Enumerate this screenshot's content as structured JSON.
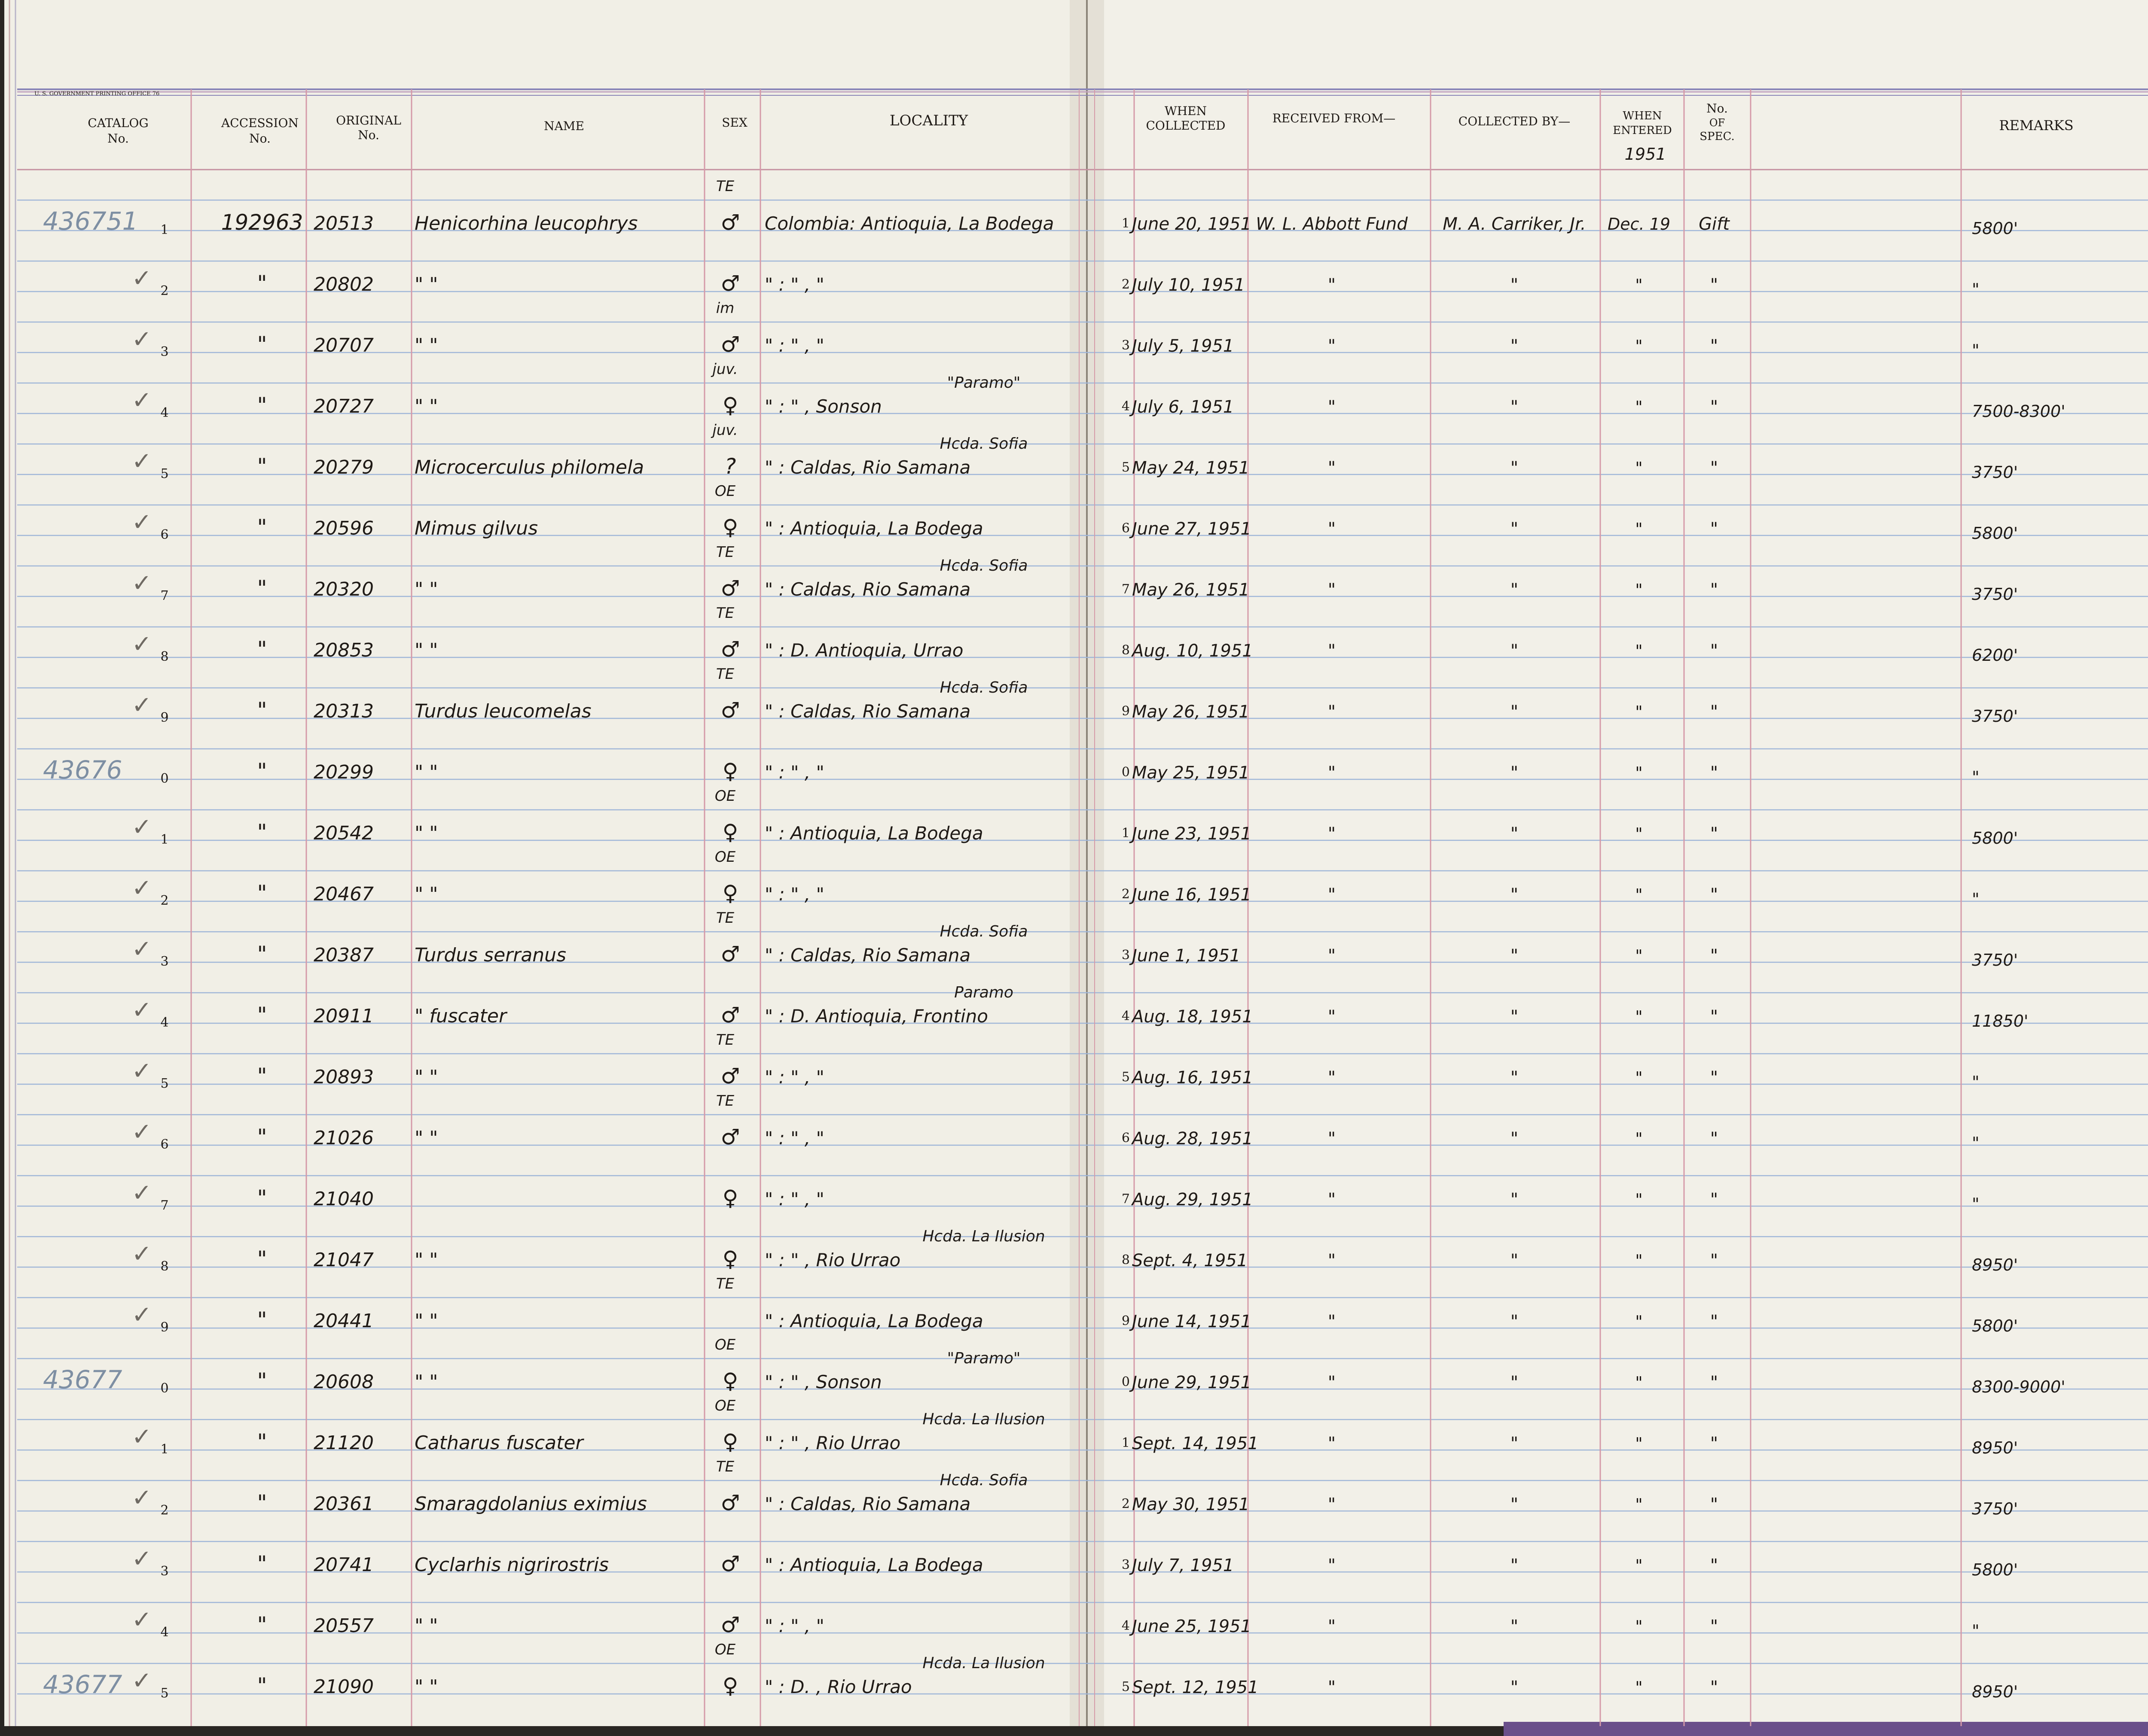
{
  "printer_imprint": "U. S. GOVERNMENT PRINTING OFFICE   76",
  "headers": {
    "catalog_no": [
      "CATALOG",
      "No."
    ],
    "accession_no": [
      "ACCESSION",
      "No."
    ],
    "original_no": [
      "ORIGINAL",
      "No."
    ],
    "name": "NAME",
    "sex": "SEX",
    "locality": "LOCALITY",
    "when_collected": [
      "WHEN",
      "COLLECTED"
    ],
    "received_from": "RECEIVED FROM—",
    "collected_by": "COLLECTED BY—",
    "when_entered": [
      "WHEN",
      "ENTERED"
    ],
    "no_of_spec": [
      "No.",
      "OF",
      "SPEC."
    ],
    "remarks": "REMARKS",
    "year_note": "1951"
  },
  "rows": [
    {
      "check": "",
      "catalog": "436751",
      "line": "1",
      "accession": "192963",
      "original": "20513",
      "name": "Henicorhina leucophrys",
      "sex_note": "TE",
      "sex": "♂",
      "locality_note": "",
      "locality": "Colombia: Antioquia, La Bodega",
      "date": "June 20, 1951",
      "received": "W. L. Abbott Fund",
      "collector": "M. A. Carriker, Jr.",
      "entered": "Dec. 19",
      "spec": "Gift",
      "remarks": "5800'"
    },
    {
      "check": "✓",
      "catalog": "",
      "line": "2",
      "accession": "\"",
      "original": "20802",
      "name": "\"   \"",
      "sex_note": "",
      "sex": "♂",
      "locality_note": "",
      "locality": "\" : \" , \"",
      "date": "July 10, 1951",
      "received": "\"",
      "collector": "\"",
      "entered": "\"",
      "spec": "\"",
      "remarks": "\""
    },
    {
      "check": "✓",
      "catalog": "",
      "line": "3",
      "accession": "\"",
      "original": "20707",
      "name": "\"   \"",
      "sex_note": "im",
      "sex": "♂",
      "locality_note": "",
      "locality": "\" : \" , \"",
      "date": "July 5, 1951",
      "received": "\"",
      "collector": "\"",
      "entered": "\"",
      "spec": "\"",
      "remarks": "\""
    },
    {
      "check": "✓",
      "catalog": "",
      "line": "4",
      "accession": "\"",
      "original": "20727",
      "name": "\"   \"",
      "sex_note": "juv.",
      "sex": "♀",
      "locality_note": "\"Paramo\"",
      "locality": "\" : \" , Sonson",
      "date": "July 6, 1951",
      "received": "\"",
      "collector": "\"",
      "entered": "\"",
      "spec": "\"",
      "remarks": "7500-8300'"
    },
    {
      "check": "✓",
      "catalog": "",
      "line": "5",
      "accession": "\"",
      "original": "20279",
      "name": "Microcerculus philomela",
      "sex_note": "juv.",
      "sex": "?",
      "locality_note": "Hcda. Sofia",
      "locality": "\" : Caldas, Rio Samana",
      "date": "May 24, 1951",
      "received": "\"",
      "collector": "\"",
      "entered": "\"",
      "spec": "\"",
      "remarks": "3750'"
    },
    {
      "check": "✓",
      "catalog": "",
      "line": "6",
      "accession": "\"",
      "original": "20596",
      "name": "Mimus gilvus",
      "sex_note": "OE",
      "sex": "♀",
      "locality_note": "",
      "locality": "\" : Antioquia, La Bodega",
      "date": "June 27, 1951",
      "received": "\"",
      "collector": "\"",
      "entered": "\"",
      "spec": "\"",
      "remarks": "5800'"
    },
    {
      "check": "✓",
      "catalog": "",
      "line": "7",
      "accession": "\"",
      "original": "20320",
      "name": "\"   \"",
      "sex_note": "TE",
      "sex": "♂",
      "locality_note": "Hcda. Sofia",
      "locality": "\" : Caldas, Rio Samana",
      "date": "May 26, 1951",
      "received": "\"",
      "collector": "\"",
      "entered": "\"",
      "spec": "\"",
      "remarks": "3750'"
    },
    {
      "check": "✓",
      "catalog": "",
      "line": "8",
      "accession": "\"",
      "original": "20853",
      "name": "\"   \"",
      "sex_note": "TE",
      "sex": "♂",
      "locality_note": "",
      "locality": "\" : D. Antioquia, Urrao",
      "date": "Aug. 10, 1951",
      "received": "\"",
      "collector": "\"",
      "entered": "\"",
      "spec": "\"",
      "remarks": "6200'"
    },
    {
      "check": "✓",
      "catalog": "",
      "line": "9",
      "accession": "\"",
      "original": "20313",
      "name": "Turdus leucomelas",
      "sex_note": "TE",
      "sex": "♂",
      "locality_note": "Hcda. Sofia",
      "locality": "\" : Caldas, Rio Samana",
      "date": "May 26, 1951",
      "received": "\"",
      "collector": "\"",
      "entered": "\"",
      "spec": "\"",
      "remarks": "3750'"
    },
    {
      "check": "",
      "catalog": "43676",
      "line": "0",
      "accession": "\"",
      "original": "20299",
      "name": "\"   \"",
      "sex_note": "",
      "sex": "♀",
      "locality_note": "",
      "locality": "\" : \" , \"",
      "date": "May 25, 1951",
      "received": "\"",
      "collector": "\"",
      "entered": "\"",
      "spec": "\"",
      "remarks": "\""
    },
    {
      "check": "✓",
      "catalog": "",
      "line": "1",
      "accession": "\"",
      "original": "20542",
      "name": "\"   \"",
      "sex_note": "OE",
      "sex": "♀",
      "locality_note": "",
      "locality": "\" : Antioquia, La Bodega",
      "date": "June 23, 1951",
      "received": "\"",
      "collector": "\"",
      "entered": "\"",
      "spec": "\"",
      "remarks": "5800'"
    },
    {
      "check": "✓",
      "catalog": "",
      "line": "2",
      "accession": "\"",
      "original": "20467",
      "name": "\"   \"",
      "sex_note": "OE",
      "sex": "♀",
      "locality_note": "",
      "locality": "\" : \" , \"",
      "date": "June 16, 1951",
      "received": "\"",
      "collector": "\"",
      "entered": "\"",
      "spec": "\"",
      "remarks": "\""
    },
    {
      "check": "✓",
      "catalog": "",
      "line": "3",
      "accession": "\"",
      "original": "20387",
      "name": "Turdus serranus",
      "sex_note": "TE",
      "sex": "♂",
      "locality_note": "Hcda. Sofia",
      "locality": "\" : Caldas, Rio Samana",
      "date": "June 1, 1951",
      "received": "\"",
      "collector": "\"",
      "entered": "\"",
      "spec": "\"",
      "remarks": "3750'"
    },
    {
      "check": "✓",
      "catalog": "",
      "line": "4",
      "accession": "\"",
      "original": "20911",
      "name": "\" fuscater",
      "sex_note": "",
      "sex": "♂",
      "locality_note": "Paramo",
      "locality": "\" : D. Antioquia, Frontino",
      "date": "Aug. 18, 1951",
      "received": "\"",
      "collector": "\"",
      "entered": "\"",
      "spec": "\"",
      "remarks": "11850'"
    },
    {
      "check": "✓",
      "catalog": "",
      "line": "5",
      "accession": "\"",
      "original": "20893",
      "name": "\"   \"",
      "sex_note": "TE",
      "sex": "♂",
      "locality_note": "",
      "locality": "\" : \" , \"",
      "date": "Aug. 16, 1951",
      "received": "\"",
      "collector": "\"",
      "entered": "\"",
      "spec": "\"",
      "remarks": "\""
    },
    {
      "check": "✓",
      "catalog": "",
      "line": "6",
      "accession": "\"",
      "original": "21026",
      "name": "\"   \"",
      "sex_note": "TE",
      "sex": "♂",
      "locality_note": "",
      "locality": "\" : \" , \"",
      "date": "Aug. 28, 1951",
      "received": "\"",
      "collector": "\"",
      "entered": "\"",
      "spec": "\"",
      "remarks": "\""
    },
    {
      "check": "✓",
      "catalog": "",
      "line": "7",
      "accession": "\"",
      "original": "21040",
      "name": "",
      "sex_note": "",
      "sex": "♀",
      "locality_note": "",
      "locality": "\" : \" , \"",
      "date": "Aug. 29, 1951",
      "received": "\"",
      "collector": "\"",
      "entered": "\"",
      "spec": "\"",
      "remarks": "\""
    },
    {
      "check": "✓",
      "catalog": "",
      "line": "8",
      "accession": "\"",
      "original": "21047",
      "name": "\"   \"",
      "sex_note": "",
      "sex": "♀",
      "locality_note": "Hcda. La Ilusion",
      "locality": "\" : \" , Rio Urrao",
      "date": "Sept. 4, 1951",
      "received": "\"",
      "collector": "\"",
      "entered": "\"",
      "spec": "\"",
      "remarks": "8950'"
    },
    {
      "check": "✓",
      "catalog": "",
      "line": "9",
      "accession": "\"",
      "original": "20441",
      "name": "\"   \"",
      "sex_note": "TE",
      "sex": "",
      "locality_note": "",
      "locality": "\" : Antioquia, La Bodega",
      "date": "June 14, 1951",
      "received": "\"",
      "collector": "\"",
      "entered": "\"",
      "spec": "\"",
      "remarks": "5800'"
    },
    {
      "check": "",
      "catalog": "43677",
      "line": "0",
      "accession": "\"",
      "original": "20608",
      "name": "\"   \"",
      "sex_note": "OE",
      "sex": "♀",
      "locality_note": "\"Paramo\"",
      "locality": "\" : \" , Sonson",
      "date": "June 29, 1951",
      "received": "\"",
      "collector": "\"",
      "entered": "\"",
      "spec": "\"",
      "remarks": "8300-9000'"
    },
    {
      "check": "✓",
      "catalog": "",
      "line": "1",
      "accession": "\"",
      "original": "21120",
      "name": "Catharus fuscater",
      "sex_note": "OE",
      "sex": "♀",
      "locality_note": "Hcda. La Ilusion",
      "locality": "\" : \" , Rio Urrao",
      "date": "Sept. 14, 1951",
      "received": "\"",
      "collector": "\"",
      "entered": "\"",
      "spec": "\"",
      "remarks": "8950'"
    },
    {
      "check": "✓",
      "catalog": "",
      "line": "2",
      "accession": "\"",
      "original": "20361",
      "name": "Smaragdolanius eximius",
      "sex_note": "TE",
      "sex": "♂",
      "locality_note": "Hcda. Sofia",
      "locality": "\" : Caldas, Rio Samana",
      "date": "May 30, 1951",
      "received": "\"",
      "collector": "\"",
      "entered": "\"",
      "spec": "\"",
      "remarks": "3750'"
    },
    {
      "check": "✓",
      "catalog": "",
      "line": "3",
      "accession": "\"",
      "original": "20741",
      "name": "Cyclarhis nigrirostris",
      "sex_note": "",
      "sex": "♂",
      "locality_note": "",
      "locality": "\" : Antioquia, La Bodega",
      "date": "July 7, 1951",
      "received": "\"",
      "collector": "\"",
      "entered": "\"",
      "spec": "\"",
      "remarks": "5800'"
    },
    {
      "check": "✓",
      "catalog": "",
      "line": "4",
      "accession": "\"",
      "original": "20557",
      "name": "\"   \"",
      "sex_note": "",
      "sex": "♂",
      "locality_note": "",
      "locality": "\" : \" , \"",
      "date": "June 25, 1951",
      "received": "\"",
      "collector": "\"",
      "entered": "\"",
      "spec": "\"",
      "remarks": "\""
    },
    {
      "check": "✓",
      "catalog": "43677",
      "line": "5",
      "accession": "\"",
      "original": "21090",
      "name": "\"   \"",
      "sex_note": "OE",
      "sex": "♀",
      "locality_note": "Hcda. La Ilusion",
      "locality": "\" : D. , Rio Urrao",
      "date": "Sept. 12, 1951",
      "received": "\"",
      "collector": "\"",
      "entered": "\"",
      "spec": "\"",
      "remarks": "8950'"
    }
  ]
}
